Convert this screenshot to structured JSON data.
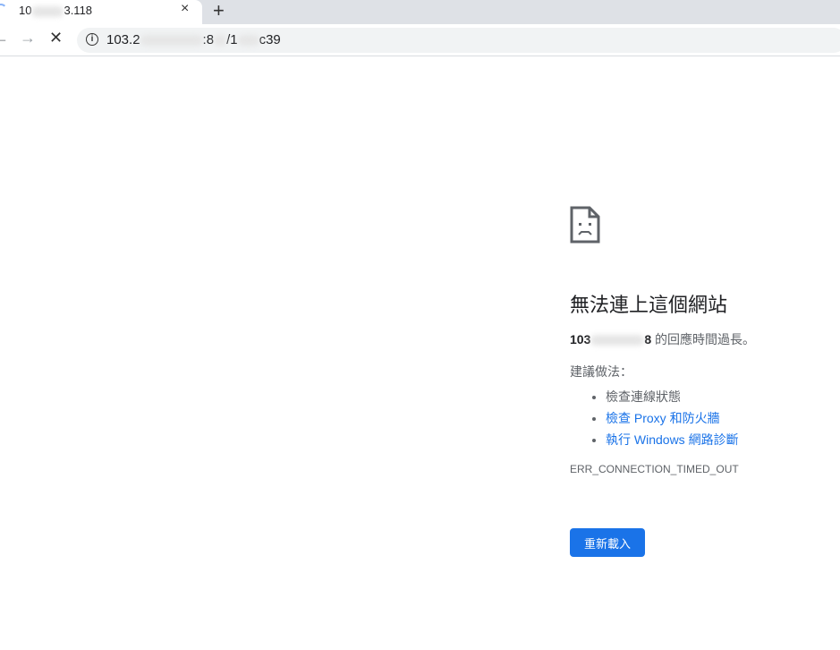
{
  "tab": {
    "title_prefix": "10",
    "title_suffix": "3.118",
    "close": "×",
    "new_tab": "+"
  },
  "toolbar": {
    "back": "←",
    "forward": "→",
    "stop": "✕",
    "info": "i",
    "url_prefix": "103.2",
    "url_mid": ":8",
    "url_mid2": "/1",
    "url_suffix": "c39"
  },
  "error": {
    "title": "無法連上這個網站",
    "host_prefix": "103",
    "host_suffix": "8",
    "message": " 的回應時間過長。",
    "suggestions_label": "建議做法：",
    "suggestions": [
      "檢查連線狀態",
      "檢查 Proxy 和防火牆",
      "執行 Windows 網路診斷"
    ],
    "code": "ERR_CONNECTION_TIMED_OUT",
    "reload": "重新載入"
  }
}
